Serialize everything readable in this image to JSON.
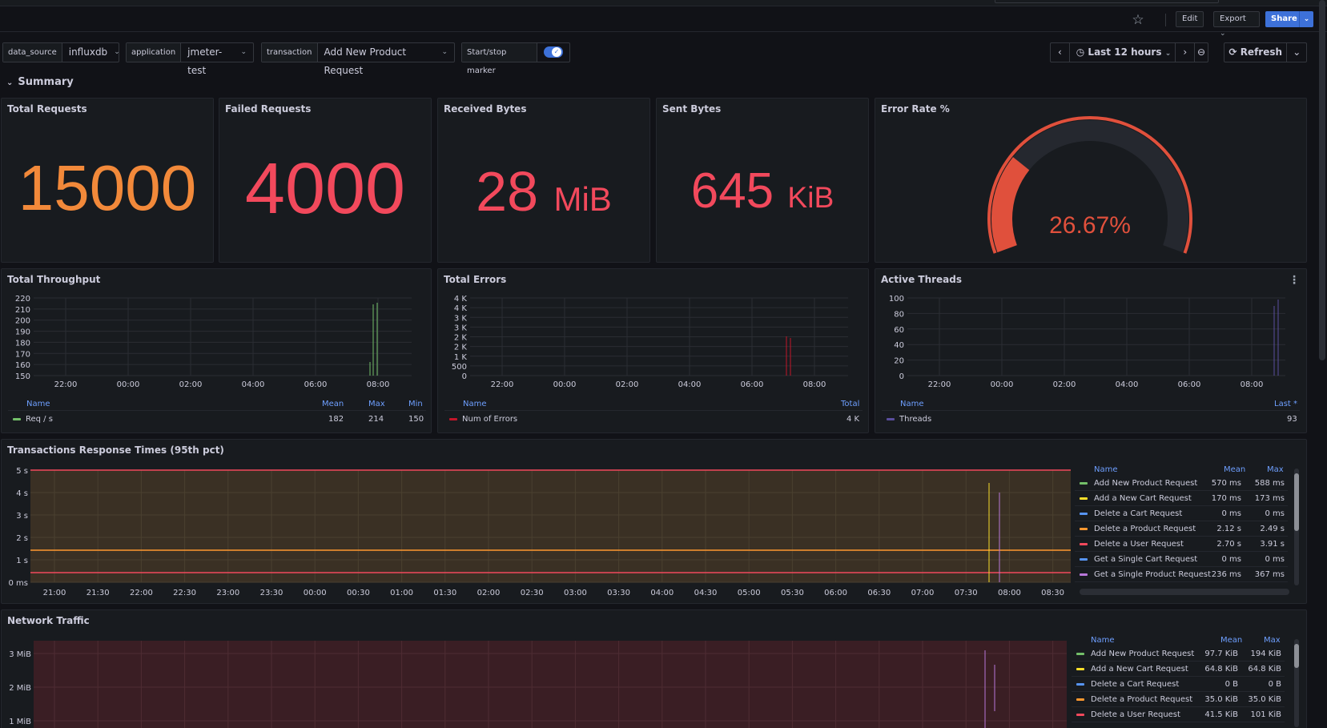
{
  "toolbar": {
    "edit": "Edit",
    "export": "Export",
    "share": "Share"
  },
  "variables": [
    {
      "label": "data_source",
      "value": "influxdb"
    },
    {
      "label": "application",
      "value": "jmeter-test"
    },
    {
      "label": "transaction",
      "value": "Add New Product Request"
    }
  ],
  "marker": {
    "label": "Start/stop marker",
    "enabled": true
  },
  "timepicker": {
    "range": "Last 12 hours",
    "refresh": "Refresh"
  },
  "row": {
    "title": "Summary"
  },
  "stats": {
    "total_requests": {
      "title": "Total Requests",
      "value": "15000",
      "color": "#f2893a"
    },
    "failed_requests": {
      "title": "Failed Requests",
      "value": "4000",
      "color": "#f2495c"
    },
    "received_bytes": {
      "title": "Received Bytes",
      "value": "28",
      "unit": "MiB",
      "color": "#f2495c"
    },
    "sent_bytes": {
      "title": "Sent Bytes",
      "value": "645",
      "unit": "KiB",
      "color": "#f2495c"
    },
    "error_rate": {
      "title": "Error Rate %",
      "value": "26.67%",
      "fraction": 0.2667,
      "color": "#e0503c"
    }
  },
  "throughput": {
    "title": "Total Throughput",
    "yticks": [
      "220",
      "210",
      "200",
      "190",
      "180",
      "170",
      "160",
      "150"
    ],
    "xticks": [
      "22:00",
      "00:00",
      "02:00",
      "04:00",
      "06:00",
      "08:00"
    ],
    "legend_headers": {
      "name": "Name",
      "mean": "Mean",
      "max": "Max",
      "min": "Min"
    },
    "series": {
      "name": "Req / s",
      "mean": "182",
      "max": "214",
      "min": "150",
      "color": "#73bf69"
    }
  },
  "errors": {
    "title": "Total Errors",
    "yticks": [
      "4 K",
      "4 K",
      "3 K",
      "3 K",
      "2 K",
      "2 K",
      "1 K",
      "500",
      "0"
    ],
    "xticks": [
      "22:00",
      "00:00",
      "02:00",
      "04:00",
      "06:00",
      "08:00"
    ],
    "legend_headers": {
      "name": "Name",
      "total": "Total"
    },
    "series": {
      "name": "Num of Errors",
      "total": "4 K",
      "color": "#c4162a"
    }
  },
  "threads": {
    "title": "Active Threads",
    "yticks": [
      "100",
      "80",
      "60",
      "40",
      "20",
      "0"
    ],
    "xticks": [
      "22:00",
      "00:00",
      "02:00",
      "04:00",
      "06:00",
      "08:00"
    ],
    "legend_headers": {
      "name": "Name",
      "last": "Last *"
    },
    "series": {
      "name": "Threads",
      "last": "93",
      "color": "#5a4e9e"
    }
  },
  "response_times": {
    "title": "Transactions Response Times (95th pct)",
    "yticks": [
      "5 s",
      "4 s",
      "3 s",
      "2 s",
      "1 s",
      "0 ms"
    ],
    "xticks": [
      "21:00",
      "21:30",
      "22:00",
      "22:30",
      "23:00",
      "23:30",
      "00:00",
      "00:30",
      "01:00",
      "01:30",
      "02:00",
      "02:30",
      "03:00",
      "03:30",
      "04:00",
      "04:30",
      "05:00",
      "05:30",
      "06:00",
      "06:30",
      "07:00",
      "07:30",
      "08:00",
      "08:30"
    ],
    "legend_headers": {
      "name": "Name",
      "mean": "Mean",
      "max": "Max"
    },
    "rows": [
      {
        "name": "Add New Product Request",
        "mean": "570 ms",
        "max": "588 ms",
        "color": "#73bf69"
      },
      {
        "name": "Add a New Cart Request",
        "mean": "170 ms",
        "max": "173 ms",
        "color": "#fade2a"
      },
      {
        "name": "Delete a Cart Request",
        "mean": "0 ms",
        "max": "0 ms",
        "color": "#5794f2"
      },
      {
        "name": "Delete a Product Request",
        "mean": "2.12 s",
        "max": "2.49 s",
        "color": "#ff9830"
      },
      {
        "name": "Delete a User Request",
        "mean": "2.70 s",
        "max": "3.91 s",
        "color": "#f2495c"
      },
      {
        "name": "Get a Single Cart Request",
        "mean": "0 ms",
        "max": "0 ms",
        "color": "#5794f2"
      },
      {
        "name": "Get a Single Product Request",
        "mean": "236 ms",
        "max": "367 ms",
        "color": "#b877d9"
      }
    ]
  },
  "network": {
    "title": "Network Traffic",
    "yticks": [
      "3 MiB",
      "2 MiB",
      "1 MiB"
    ],
    "legend_headers": {
      "name": "Name",
      "mean": "Mean",
      "max": "Max"
    },
    "rows": [
      {
        "name": "Add New Product Request",
        "mean": "97.7 KiB",
        "max": "194 KiB",
        "color": "#73bf69"
      },
      {
        "name": "Add a New Cart Request",
        "mean": "64.8 KiB",
        "max": "64.8 KiB",
        "color": "#fade2a"
      },
      {
        "name": "Delete a Cart Request",
        "mean": "0 B",
        "max": "0 B",
        "color": "#5794f2"
      },
      {
        "name": "Delete a Product Request",
        "mean": "35.0 KiB",
        "max": "35.0 KiB",
        "color": "#ff9830"
      },
      {
        "name": "Delete a User Request",
        "mean": "41.5 KiB",
        "max": "101 KiB",
        "color": "#f2495c"
      }
    ]
  }
}
